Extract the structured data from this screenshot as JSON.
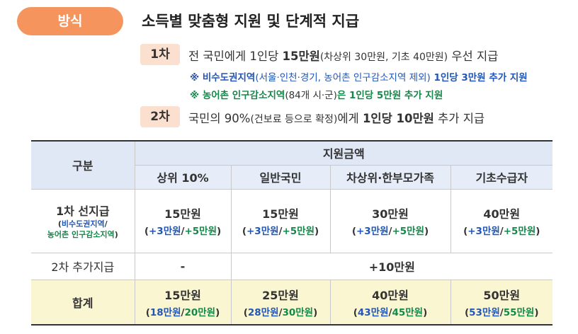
{
  "header": {
    "badge": "방식",
    "title": "소득별 맞춤형 지원 및 단계적 지급"
  },
  "step1": {
    "tag": "1차",
    "text_a": "전 국민에게 1인당 ",
    "text_b": "15만원",
    "text_c": "(차상위 30만원, 기초 40만원)",
    "text_d": " 우선 지급",
    "note1_a": "※ 비수도권지역",
    "note1_b": "(서울·인천·경기, 농어촌 인구감소지역 제외)",
    "note1_c": " 1인당 3만원 추가 지원",
    "note2_a": "※ 농어촌 인구감소지역",
    "note2_b": "(84개 시·군)",
    "note2_c": "은 1인당 5만원 추가 지원"
  },
  "step2": {
    "tag": "2차",
    "text_a": "국민의 90%",
    "text_b": "(건보료 등으로 확정)",
    "text_c": "에게 ",
    "text_d": "1인당 10만원",
    "text_e": " 추가 지급"
  },
  "table": {
    "corner": "구분",
    "group_header": "지원금액",
    "columns": [
      "상위 10%",
      "일반국민",
      "차상위·한부모가족",
      "기초수급자"
    ],
    "row1": {
      "label": "1차 선지급",
      "sub_open": "(",
      "sub_blue": "비수도권지역",
      "sub_slash": "/",
      "sub_green": "농어촌 인구감소지역",
      "sub_close": ")",
      "cells": [
        {
          "main": "15만원",
          "a": "+3만원",
          "b": "+5만원"
        },
        {
          "main": "15만원",
          "a": "+3만원",
          "b": "+5만원"
        },
        {
          "main": "30만원",
          "a": "+3만원",
          "b": "+5만원"
        },
        {
          "main": "40만원",
          "a": "+3만원",
          "b": "+5만원"
        }
      ]
    },
    "row2": {
      "label": "2차 추가지급",
      "first": "-",
      "rest": "+10만원"
    },
    "row3": {
      "label": "합계",
      "cells": [
        {
          "main": "15만원",
          "a": "18만원",
          "b": "20만원"
        },
        {
          "main": "25만원",
          "a": "28만원",
          "b": "30만원"
        },
        {
          "main": "40만원",
          "a": "43만원",
          "b": "45만원"
        },
        {
          "main": "50만원",
          "a": "53만원",
          "b": "55만원"
        }
      ]
    }
  },
  "colors": {
    "badge": "#f5945c",
    "tag": "#fbe0cf",
    "header_bg": "#e0e8f6",
    "total_bg": "#fbf6d2",
    "blue": "#2156b8",
    "green": "#14884a"
  }
}
